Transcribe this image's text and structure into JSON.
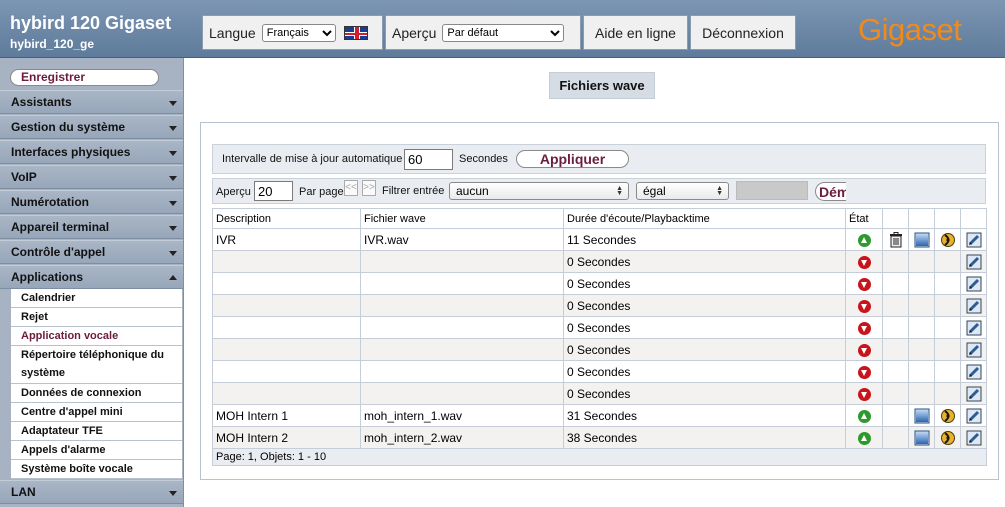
{
  "header": {
    "device_title": "hybird 120 Gigaset",
    "device_subtitle": "hybird_120_ge",
    "language_label": "Langue",
    "language_value": "Français",
    "view_label": "Aperçu",
    "view_value": "Par défaut",
    "help_label": "Aide en ligne",
    "logout_label": "Déconnexion",
    "logo_text": "Gigaset",
    "logo_color": "#f08a1c"
  },
  "sidebar": {
    "register_label": "Enregistrer",
    "menu": [
      "Assistants",
      "Gestion du système",
      "Interfaces physiques",
      "VoIP",
      "Numérotation",
      "Appareil terminal",
      "Contrôle d'appel",
      "Applications",
      "LAN"
    ],
    "sub_items": [
      "Calendrier",
      "Rejet",
      "Application vocale",
      "Répertoire téléphonique du système",
      "Données de connexion",
      "Centre d'appel mini",
      "Adaptateur TFE",
      "Appels d'alarme",
      "Système boîte vocale"
    ],
    "active_sub_item": "Application vocale"
  },
  "main": {
    "title": "Fichiers wave",
    "refresh": {
      "label": "Intervalle de mise à jour automatique",
      "value": "60",
      "unit": "Secondes",
      "apply_label": "Appliquer"
    },
    "filter": {
      "view_label": "Aperçu",
      "view_value": "20",
      "per_page_label": "Par page",
      "prev_label": "<<",
      "next_label": ">>",
      "filter_label": "Filtrer entrée",
      "filter_value": "aucun",
      "operator_value": "égal",
      "start_label": "Dém"
    },
    "table": {
      "headers": [
        "Description",
        "Fichier wave",
        "Durée d'écoute/Playbacktime",
        "État"
      ],
      "rows": [
        {
          "description": "IVR",
          "file": "IVR.wav",
          "duration": "11 Secondes",
          "state": "up",
          "delete": true,
          "details": true,
          "play": true,
          "edit": true
        },
        {
          "description": "",
          "file": "",
          "duration": "0 Secondes",
          "state": "down",
          "delete": false,
          "details": false,
          "play": false,
          "edit": true
        },
        {
          "description": "",
          "file": "",
          "duration": "0 Secondes",
          "state": "down",
          "delete": false,
          "details": false,
          "play": false,
          "edit": true
        },
        {
          "description": "",
          "file": "",
          "duration": "0 Secondes",
          "state": "down",
          "delete": false,
          "details": false,
          "play": false,
          "edit": true
        },
        {
          "description": "",
          "file": "",
          "duration": "0 Secondes",
          "state": "down",
          "delete": false,
          "details": false,
          "play": false,
          "edit": true
        },
        {
          "description": "",
          "file": "",
          "duration": "0 Secondes",
          "state": "down",
          "delete": false,
          "details": false,
          "play": false,
          "edit": true
        },
        {
          "description": "",
          "file": "",
          "duration": "0 Secondes",
          "state": "down",
          "delete": false,
          "details": false,
          "play": false,
          "edit": true
        },
        {
          "description": "",
          "file": "",
          "duration": "0 Secondes",
          "state": "down",
          "delete": false,
          "details": false,
          "play": false,
          "edit": true
        },
        {
          "description": "MOH Intern 1",
          "file": "moh_intern_1.wav",
          "duration": "31 Secondes",
          "state": "up",
          "delete": false,
          "details": true,
          "play": true,
          "edit": true
        },
        {
          "description": "MOH Intern 2",
          "file": "moh_intern_2.wav",
          "duration": "38 Secondes",
          "state": "up",
          "delete": false,
          "details": true,
          "play": true,
          "edit": true
        }
      ],
      "footer": "Page:  1, Objets:  1 - 10"
    },
    "icons": {
      "state_up": "arrow-up-circle-icon",
      "state_down": "arrow-down-circle-icon",
      "delete": "trash-icon",
      "details": "window-icon",
      "play": "play-sound-icon",
      "edit": "edit-icon"
    },
    "colors": {
      "accent": "#6b1d3e",
      "state_up": "#2c9a2c",
      "state_down": "#c8141c"
    }
  }
}
